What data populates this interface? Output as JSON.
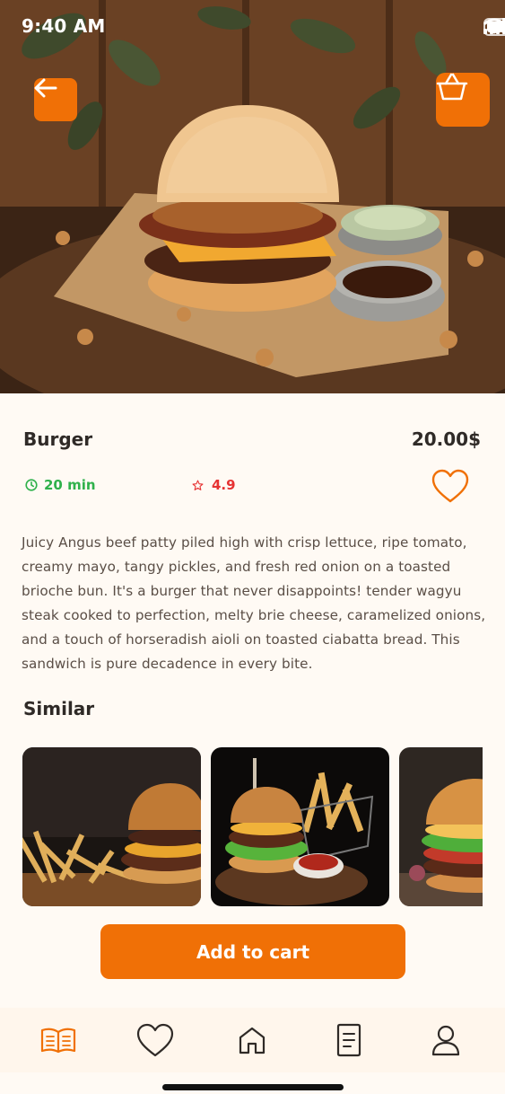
{
  "status_bar": {
    "time": "9:40 AM"
  },
  "product": {
    "name": "Burger",
    "price": "20.00$",
    "prep_time": "20 min",
    "rating": "4.9",
    "favorited": false,
    "description": "Juicy Angus beef patty piled high with crisp lettuce, ripe tomato, creamy mayo, tangy pickles, and fresh red onion on a toasted brioche bun. It's a burger that never disappoints! tender wagyu steak cooked to perfection, melty brie cheese, caramelized onions, and a touch of horseradish aioli on toasted ciabatta bread. This sandwich is pure decadence in every bite."
  },
  "similar": {
    "title": "Similar",
    "items": [
      {
        "image": "burger-with-fries-photo"
      },
      {
        "image": "burger-fries-sauce-photo"
      },
      {
        "image": "burger-with-vegetables-photo"
      }
    ]
  },
  "actions": {
    "add_to_cart": "Add to cart"
  },
  "tabbar": {
    "items": [
      {
        "icon": "menu-book-icon",
        "active": true
      },
      {
        "icon": "heart-icon",
        "active": false
      },
      {
        "icon": "home-icon",
        "active": false
      },
      {
        "icon": "orders-icon",
        "active": false
      },
      {
        "icon": "profile-icon",
        "active": false
      }
    ]
  },
  "colors": {
    "accent": "#f07006",
    "background": "#fffaf4",
    "text": "#2f2a27",
    "time_green": "#2fb14b",
    "rating_red": "#e63232"
  }
}
